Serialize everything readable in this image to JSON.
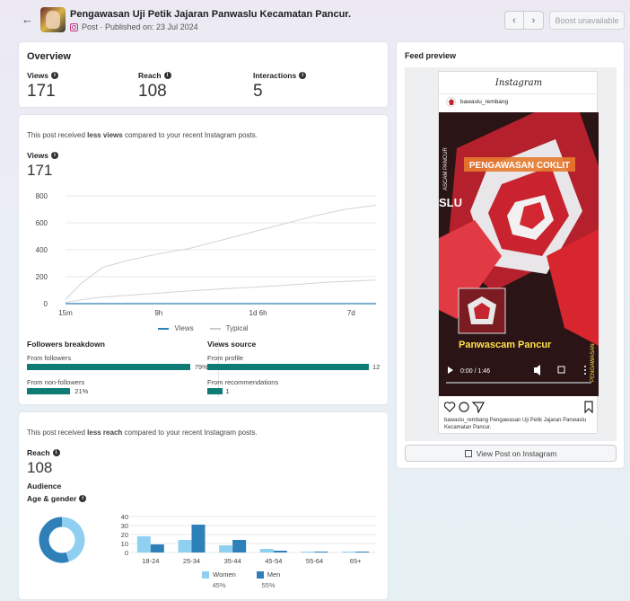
{
  "header": {
    "back_icon": "arrow-left-icon",
    "title": "Pengawasan Uji Petik Jajaran Panwaslu Kecamatan Pancur.",
    "subtitle": "Post · Published on: 23 Jul 2024",
    "prev_icon": "chevron-left-icon",
    "next_icon": "chevron-right-icon",
    "prev_glyph": "‹",
    "next_glyph": "›",
    "boost_label": "Boost unavailable"
  },
  "overview": {
    "title": "Overview",
    "metrics": [
      {
        "label": "Views",
        "value": "171"
      },
      {
        "label": "Reach",
        "value": "108"
      },
      {
        "label": "Interactions",
        "value": "5"
      }
    ]
  },
  "views_card": {
    "note_prefix": "This post received ",
    "note_bold": "less views",
    "note_suffix": " compared to your recent Instagram posts.",
    "label": "Views",
    "value": "171",
    "legend_views": "Views",
    "legend_typical": "Typical",
    "followers": {
      "title": "Followers breakdown",
      "from_followers_label": "From followers",
      "from_followers_pct": "79%",
      "from_followers_value": 79,
      "from_nonfollowers_label": "From non-followers",
      "from_nonfollowers_pct": "21%",
      "from_nonfollowers_value": 21
    },
    "source": {
      "title": "Views source",
      "profile_label": "From profile",
      "profile_value": "12",
      "recs_label": "From recommendations",
      "recs_value": "1"
    }
  },
  "reach_card": {
    "note_prefix": "This post received ",
    "note_bold": "less reach",
    "note_suffix": " compared to your recent Instagram posts.",
    "label": "Reach",
    "value": "108",
    "audience_title": "Audience",
    "age_gender_title": "Age & gender",
    "women_label": "Women",
    "women_pct": "45%",
    "men_label": "Men",
    "men_pct": "55%"
  },
  "feed_preview": {
    "title": "Feed preview",
    "platform": "Instagram",
    "username": "bawaslu_rembang",
    "media_text_1": "PENGAWASAN COKLIT",
    "media_text_2": "SLU",
    "media_text_3": "Panwascam Pancur",
    "media_side_left": "ASCAM PANCUR",
    "media_side_right": "PENGAWASAN",
    "media_time": "0:00 / 1:46",
    "caption": "bawaslu_rembang Pengawasan Uji Petik Jajaran Panwaslu Kecamatan Pancur.",
    "view_button": "View Post on Instagram"
  },
  "colors": {
    "teal": "#0e7c74",
    "views_line": "#2f7fb8",
    "typical_line": "#d2d5d9",
    "women": "#8fd0f0",
    "men": "#2f7fb8"
  },
  "chart_data": [
    {
      "type": "line",
      "title": "",
      "x": [
        "15m",
        "9h",
        "1d 6h",
        "7d"
      ],
      "ylim": [
        0,
        800
      ],
      "yticks": [
        "0",
        "200",
        "400",
        "600",
        "800"
      ],
      "series": [
        {
          "name": "Views",
          "x": [
            0,
            0.25,
            0.5,
            0.75,
            1
          ],
          "values": [
            0,
            0,
            0,
            0,
            0
          ]
        },
        {
          "name": "Typical",
          "x": [
            0,
            0.05,
            0.12,
            0.2,
            0.3,
            0.4,
            0.5,
            0.6,
            0.7,
            0.8,
            0.9,
            1.0
          ],
          "values": [
            30,
            150,
            270,
            320,
            370,
            410,
            470,
            530,
            590,
            650,
            700,
            730
          ]
        },
        {
          "name": "Typical-lower",
          "x": [
            0,
            0.1,
            0.25,
            0.4,
            0.55,
            0.7,
            0.85,
            1.0
          ],
          "values": [
            10,
            45,
            70,
            95,
            115,
            135,
            160,
            175
          ]
        }
      ]
    },
    {
      "type": "bar",
      "title": "Age & gender",
      "categories": [
        "18-24",
        "25-34",
        "35-44",
        "45-54",
        "55-64",
        "65+"
      ],
      "ylim": [
        0,
        40
      ],
      "yticks": [
        "0",
        "10",
        "20",
        "30",
        "40"
      ],
      "series": [
        {
          "name": "Women",
          "values": [
            18,
            14,
            8,
            4,
            1,
            1
          ]
        },
        {
          "name": "Men",
          "values": [
            9,
            31,
            14,
            2,
            1,
            1
          ]
        }
      ]
    },
    {
      "type": "pie",
      "categories": [
        "Women",
        "Men"
      ],
      "values": [
        45,
        55
      ]
    }
  ]
}
